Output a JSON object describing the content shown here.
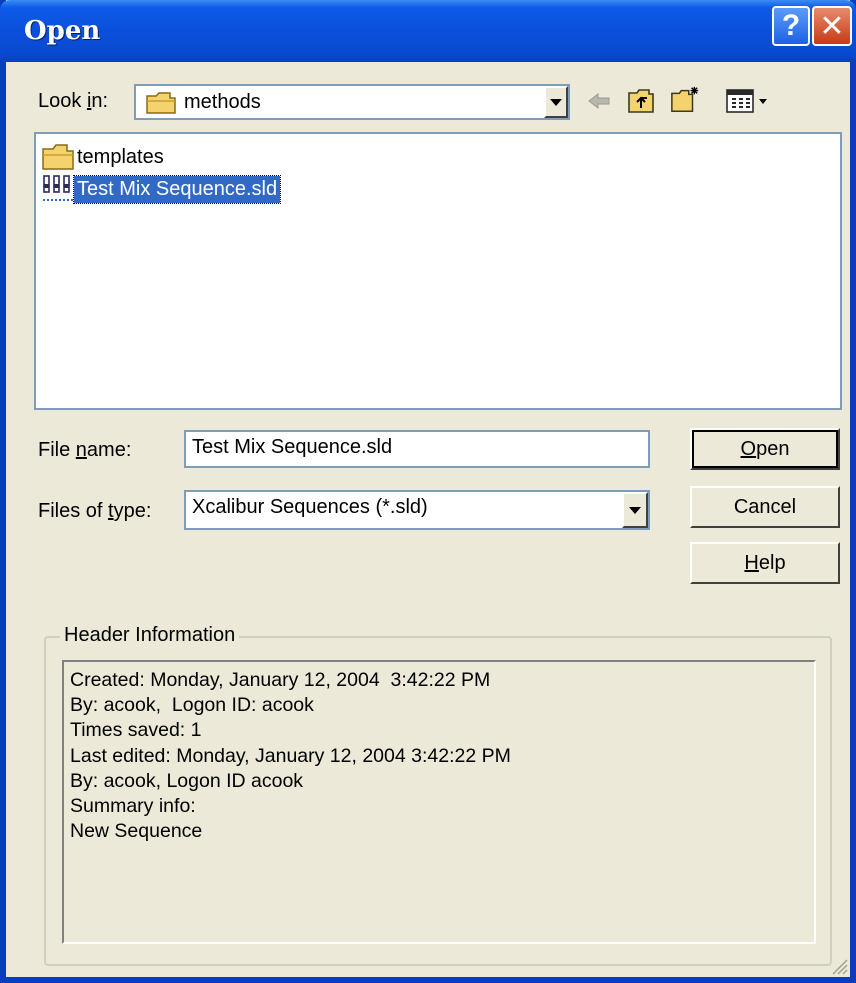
{
  "window": {
    "title": "Open",
    "help_icon": "question-mark-icon",
    "close_icon": "close-x-icon"
  },
  "lookin": {
    "label_pre": "Look ",
    "label_key": "i",
    "label_post": "n:",
    "value": "methods",
    "icon": "folder-icon"
  },
  "toolbar": {
    "icons": [
      "back-arrow-icon",
      "up-one-level-icon",
      "new-folder-icon",
      "view-menu-icon"
    ]
  },
  "files": [
    {
      "name": "templates",
      "icon": "folder-icon",
      "selected": false
    },
    {
      "name": "Test Mix Sequence.sld",
      "icon": "sequence-file-icon",
      "selected": true
    }
  ],
  "filename": {
    "label_pre": "File ",
    "label_key": "n",
    "label_post": "ame:",
    "value": "Test Mix Sequence.sld"
  },
  "filetype": {
    "label_pre": "Files of ",
    "label_key": "t",
    "label_post": "ype:",
    "value": "Xcalibur Sequences (*.sld)"
  },
  "buttons": {
    "open_key": "O",
    "open_rest": "pen",
    "cancel": "Cancel",
    "help_key": "H",
    "help_rest": "elp"
  },
  "header_info": {
    "title": "Header Information",
    "lines": [
      "Created: Monday, January 12, 2004  3:42:22 PM",
      "By: acook,  Logon ID: acook",
      "Times saved: 1",
      "Last edited: Monday, January 12, 2004 3:42:22 PM",
      "By: acook, Logon ID acook",
      "Summary info:",
      "New Sequence"
    ]
  },
  "colors": {
    "title_bar": "#0A4FDB",
    "dialog_bg": "#ECE9D8",
    "selection": "#316AC5",
    "close_button": "#C93A13"
  }
}
